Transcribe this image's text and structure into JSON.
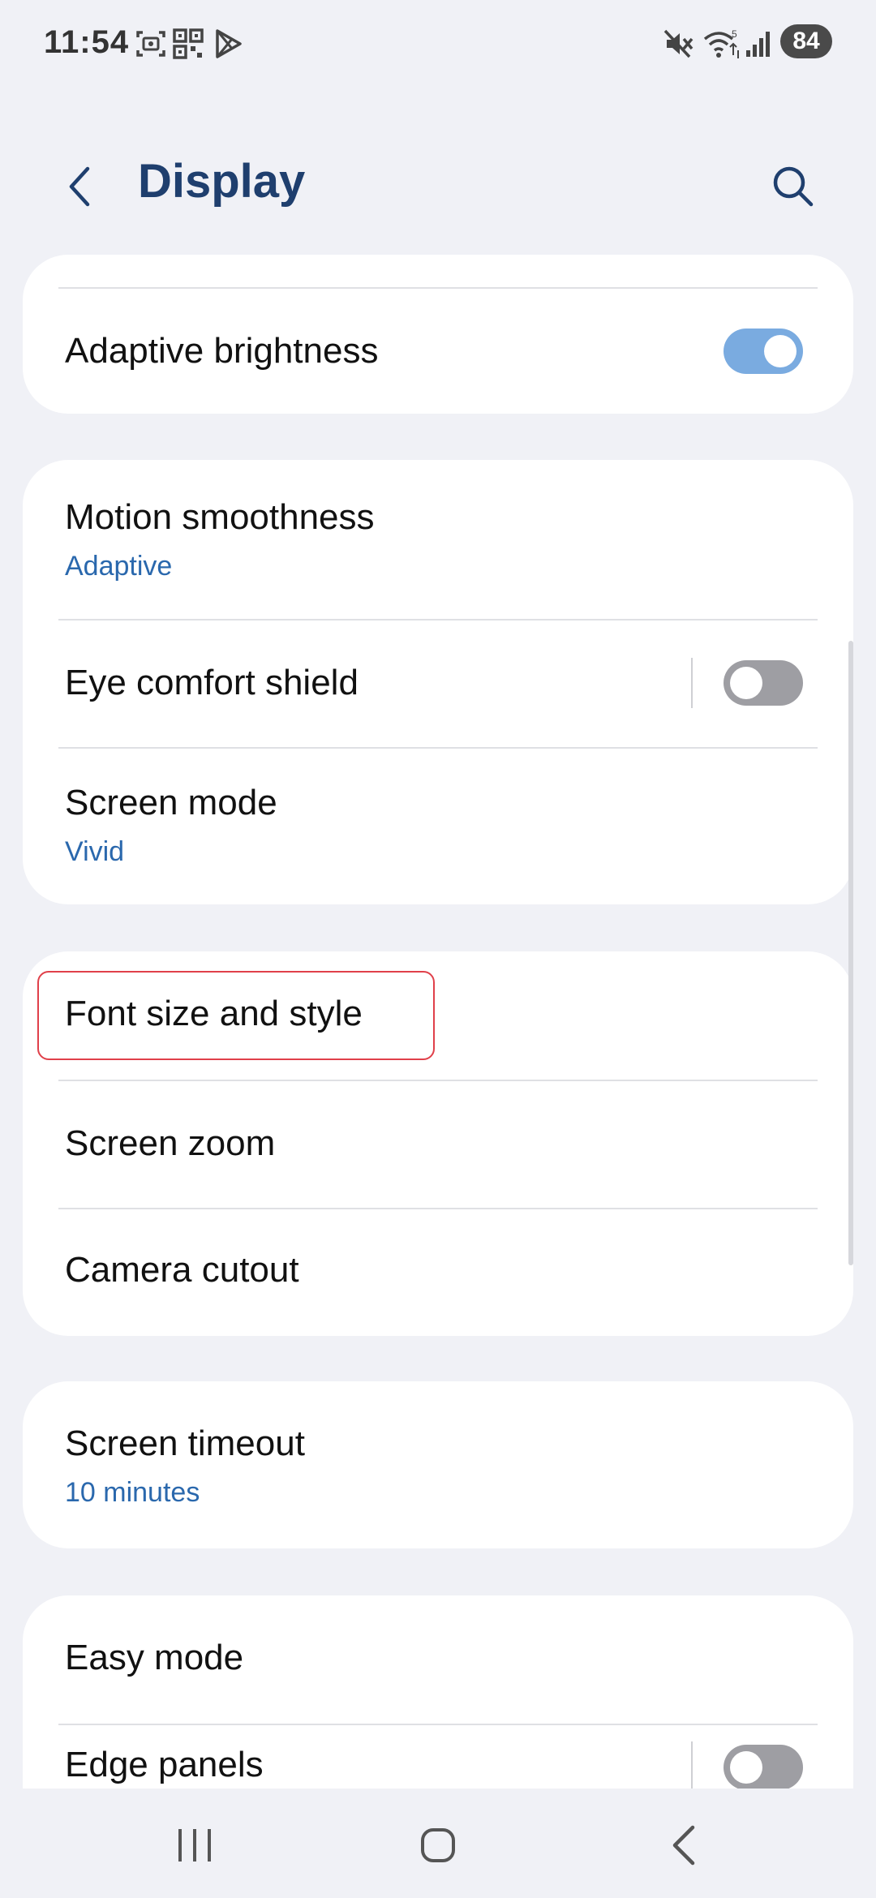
{
  "status_bar": {
    "time": "11:54",
    "battery": "84",
    "icons": [
      "screenshot-icon",
      "qr-icon",
      "play-store-icon",
      "mute-icon",
      "wifi-icon",
      "signal-icon",
      "battery-icon"
    ]
  },
  "header": {
    "title": "Display",
    "back_icon": "back-arrow-icon",
    "search_icon": "search-icon"
  },
  "groups": [
    {
      "items": [
        {
          "label": "Adaptive brightness",
          "toggle": true
        }
      ]
    },
    {
      "items": [
        {
          "label": "Motion smoothness",
          "value": "Adaptive"
        },
        {
          "label": "Eye comfort shield",
          "toggle": false
        },
        {
          "label": "Screen mode",
          "value": "Vivid"
        }
      ]
    },
    {
      "items": [
        {
          "label": "Font size and style",
          "highlighted": true
        },
        {
          "label": "Screen zoom"
        },
        {
          "label": "Camera cutout"
        }
      ]
    },
    {
      "items": [
        {
          "label": "Screen timeout",
          "value": "10 minutes"
        }
      ]
    },
    {
      "items": [
        {
          "label": "Easy mode"
        },
        {
          "label": "Edge panels",
          "toggle": false
        }
      ]
    }
  ],
  "colors": {
    "background": "#f0f1f6",
    "title": "#1f3f6e",
    "accent_value": "#2a68ad",
    "toggle_on": "#7aabe0",
    "toggle_off": "#9e9ea3",
    "highlight": "#e0404a"
  },
  "nav_bar": {
    "buttons": [
      "recent-apps-icon",
      "home-icon",
      "back-icon"
    ]
  }
}
